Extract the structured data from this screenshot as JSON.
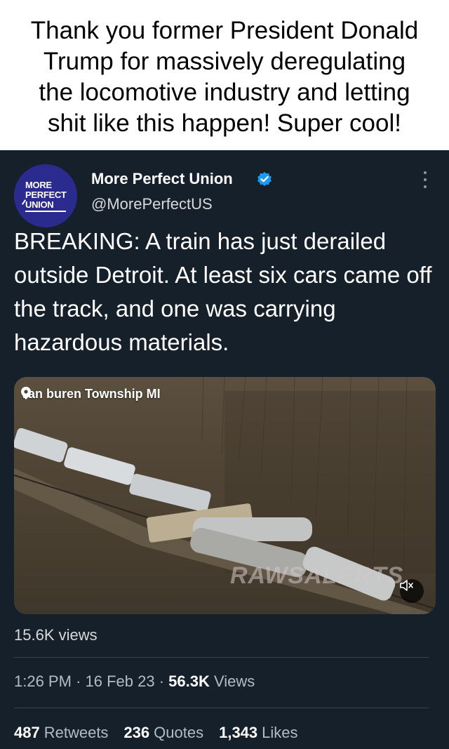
{
  "caption": {
    "lines": [
      "Thank you former President Donald",
      "Trump for massively deregulating",
      "the locomotive industry and letting",
      "shit like this happen! Super cool!"
    ]
  },
  "tweet": {
    "avatar_text": [
      "MORE",
      "PERFECT",
      "UNION"
    ],
    "name": "More Perfect Union",
    "handle": "@MorePerfectUS",
    "text": "BREAKING: A train has just derailed outside Detroit. At least six cars came off the track, and one was carrying hazardous materials.",
    "media": {
      "location": "van buren Township MI",
      "watermark": "RAWSALERTS"
    },
    "view_count": "15.6K views",
    "time": "1:26 PM",
    "date": "16 Feb 23",
    "views_number": "56.3K",
    "views_label": "Views",
    "retweets": "487",
    "retweets_label": "Retweets",
    "quotes": "236",
    "quotes_label": "Quotes",
    "likes": "1,343",
    "likes_label": "Likes",
    "separator": "·"
  },
  "colors": {
    "background": "#15202b",
    "verified": "#1d9bf0",
    "avatar": "#2b2a8f"
  },
  "icons": [
    "verified-badge-icon",
    "more-options-icon",
    "location-pin-icon",
    "mute-icon"
  ]
}
